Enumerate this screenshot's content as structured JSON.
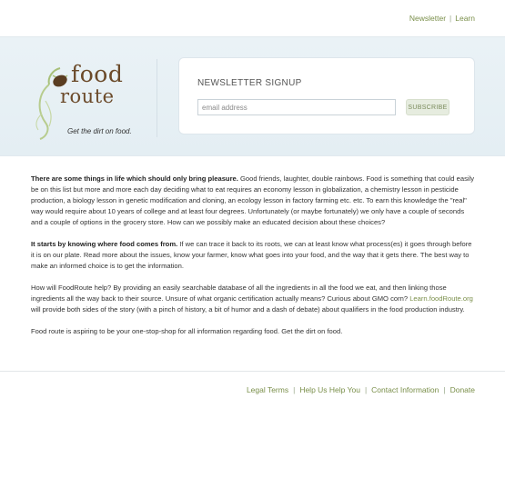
{
  "top_nav": {
    "newsletter": "Newsletter",
    "separator": "|",
    "learn": "Learn"
  },
  "logo": {
    "word1": "food",
    "word2": "route",
    "tagline": "Get the dirt on food.",
    "colors": {
      "text": "#6b4a2a",
      "sprout": "#a8c07a",
      "seed": "#5a3d22"
    }
  },
  "signup": {
    "title": "NEWSLETTER SIGNUP",
    "email_placeholder": "email address",
    "subscribe_label": "SUBSCRIBE"
  },
  "content": {
    "p1_strong": "There are some things in life which should only bring pleasure.",
    "p1_text": " Good friends, laughter, double rainbows. Food is something that could easily be on this list but more and more each day deciding what to eat requires an economy lesson in globalization, a chemistry lesson in pesticide production, a biology lesson in genetic modification and cloning, an ecology lesson in factory farming etc. etc. To earn this knowledge the \"real\" way would require about 10 years of college and at least four degrees. Unfortunately (or maybe fortunately) we only have a couple of seconds and a couple of options in the grocery store. How can we possibly make an educated decision about these choices?",
    "p2_strong": "It starts by knowing where food comes from.",
    "p2_text": " If we can trace it back to its roots, we can at least know what process(es) it goes through before it is on our plate. Read more about the issues, know your farmer, know what goes into your food, and the way that it gets there. The best way to make an informed choice is to get the information.",
    "p3_text": "How will FoodRoute help? By providing an easily searchable database of all the ingredients in all the food we eat, and then linking those ingredients all the way back to their source. Unsure of what organic certification actually means? Curious about GMO corn? ",
    "p3_link": "Learn.foodRoute.org",
    "p3_text2": " will provide both sides of the story (with a pinch of history, a bit of humor and a dash of debate) about qualifiers in the food production industry.",
    "p4_text": "Food route is aspiring to be your one-stop-shop for all information regarding food. Get the dirt on food."
  },
  "footer": {
    "legal": "Legal Terms",
    "help": "Help Us Help You",
    "contact": "Contact Information",
    "donate": "Donate",
    "separator": "|"
  }
}
